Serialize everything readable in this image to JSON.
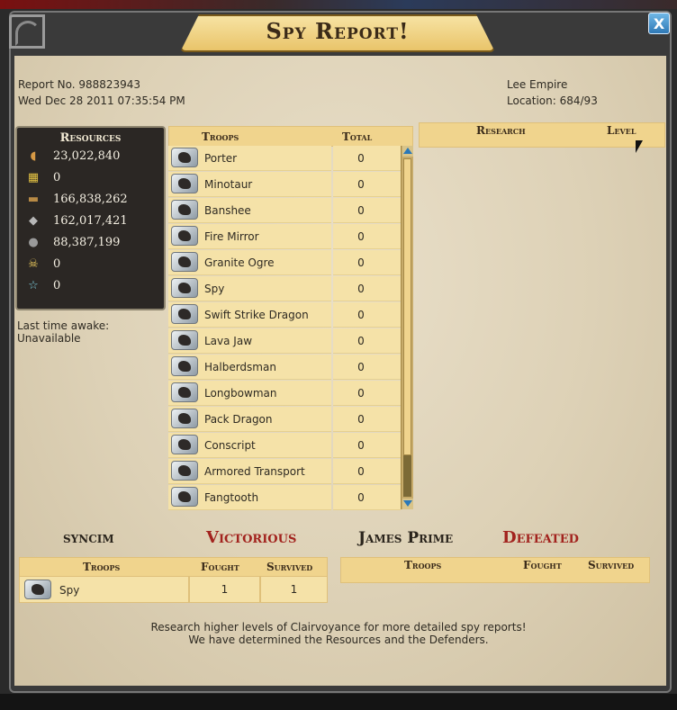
{
  "window": {
    "title": "Spy Report!",
    "close_label": "X"
  },
  "report": {
    "number": "Report No. 988823943",
    "date": "Wed Dec 28 2011 07:35:54 PM",
    "empire": "Lee Empire",
    "location": "Location: 684/93"
  },
  "resources": {
    "title": "Resources",
    "items": [
      {
        "icon": "food-icon",
        "value": "23,022,840"
      },
      {
        "icon": "gold-icon",
        "value": "0"
      },
      {
        "icon": "wood-icon",
        "value": "166,838,262"
      },
      {
        "icon": "ore-icon",
        "value": "162,017,421"
      },
      {
        "icon": "stone-icon",
        "value": "88,387,199"
      },
      {
        "icon": "skull-icon",
        "value": "0"
      },
      {
        "icon": "star-icon",
        "value": "0"
      }
    ]
  },
  "awake": {
    "label": "Last time awake:",
    "value": "Unavailable"
  },
  "troops_table": {
    "header_troops": "Troops",
    "header_total": "Total",
    "rows": [
      {
        "name": "Porter",
        "total": "0"
      },
      {
        "name": "Minotaur",
        "total": "0"
      },
      {
        "name": "Banshee",
        "total": "0"
      },
      {
        "name": "Fire Mirror",
        "total": "0"
      },
      {
        "name": "Granite Ogre",
        "total": "0"
      },
      {
        "name": "Spy",
        "total": "0"
      },
      {
        "name": "Swift Strike Dragon",
        "total": "0"
      },
      {
        "name": "Lava Jaw",
        "total": "0"
      },
      {
        "name": "Halberdsman",
        "total": "0"
      },
      {
        "name": "Longbowman",
        "total": "0"
      },
      {
        "name": "Pack Dragon",
        "total": "0"
      },
      {
        "name": "Conscript",
        "total": "0"
      },
      {
        "name": "Armored Transport",
        "total": "0"
      },
      {
        "name": "Fangtooth",
        "total": "0"
      }
    ]
  },
  "research_table": {
    "header_research": "Research",
    "header_level": "Level"
  },
  "attacker": {
    "name": "syncim",
    "result": "Victorious",
    "header_troops": "Troops",
    "header_fought": "Fought",
    "header_survived": "Survived",
    "rows": [
      {
        "name": "Spy",
        "fought": "1",
        "survived": "1"
      }
    ]
  },
  "defender": {
    "name": "James Prime",
    "result": "Defeated",
    "header_troops": "Troops",
    "header_fought": "Fought",
    "header_survived": "Survived"
  },
  "footer": {
    "line1": "Research higher levels of Clairvoyance for more detailed spy reports!",
    "line2": "We have determined the Resources and the Defenders."
  },
  "colors": {
    "result_red": "#a2231e",
    "header_gold": "#f0d48d",
    "cell_cream": "#f5e2a8",
    "close_blue": "#2f79b6"
  }
}
